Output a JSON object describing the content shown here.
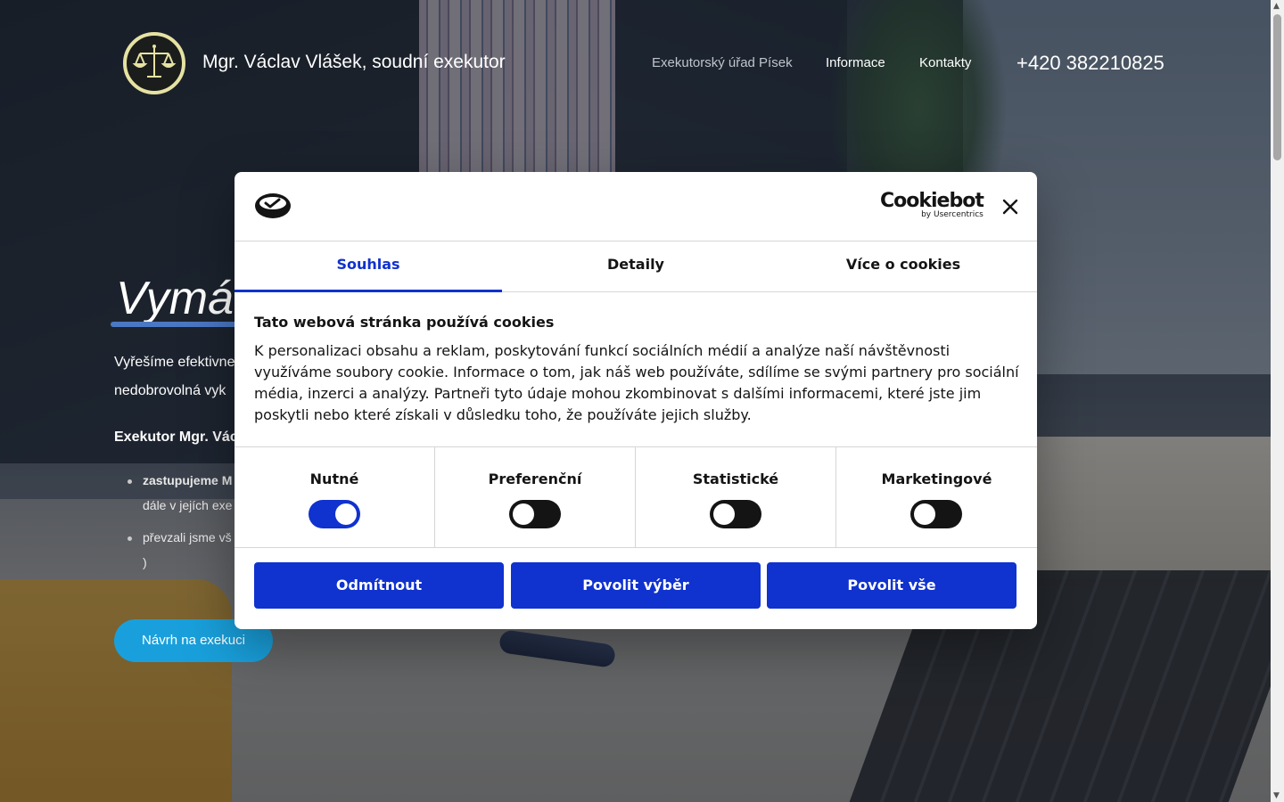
{
  "header": {
    "brand": "Mgr. Václav Vlášek, soudní exekutor",
    "nav": [
      "Exekutorský úřad Písek",
      "Informace",
      "Kontakty"
    ],
    "phone": "+420 382210825"
  },
  "hero": {
    "title": "Vymá",
    "paragraph_line1": "Vyřešíme efektivne",
    "paragraph_line2": "nedobrovolná vyk",
    "strong": "Exekutor Mgr. Vác",
    "list": [
      {
        "line1": "zastupujeme M",
        "line2": "dále v jejích exe"
      },
      {
        "line1": "převzali jsme vš",
        "line2": ")"
      }
    ],
    "button": "Návrh na exekuci"
  },
  "cookie_dialog": {
    "brand": "Cookiebot",
    "brand_sub": "by Usercentrics",
    "tabs": [
      "Souhlas",
      "Detaily",
      "Více o cookies"
    ],
    "active_tab": "Souhlas",
    "title": "Tato webová stránka používá cookies",
    "text": "K personalizaci obsahu a reklam, poskytování funkcí sociálních médií a analýze naší návštěvnosti využíváme soubory cookie. Informace o tom, jak náš web používáte, sdílíme se svými partnery pro sociální média, inzerci a analýzy. Partneři tyto údaje mohou zkombinovat s dalšími informacemi, které jste jim poskytli nebo které získali v důsledku toho, že používáte jejich služby.",
    "categories": [
      {
        "label": "Nutné",
        "enabled": true
      },
      {
        "label": "Preferenční",
        "enabled": false
      },
      {
        "label": "Statistické",
        "enabled": false
      },
      {
        "label": "Marketingové",
        "enabled": false
      }
    ],
    "buttons": {
      "deny": "Odmítnout",
      "allow_selection": "Povolit výběr",
      "allow_all": "Povolit vše"
    }
  },
  "colors": {
    "accent": "#1032cf",
    "hero_button": "#19a0dc",
    "toggle_off": "#141414"
  }
}
